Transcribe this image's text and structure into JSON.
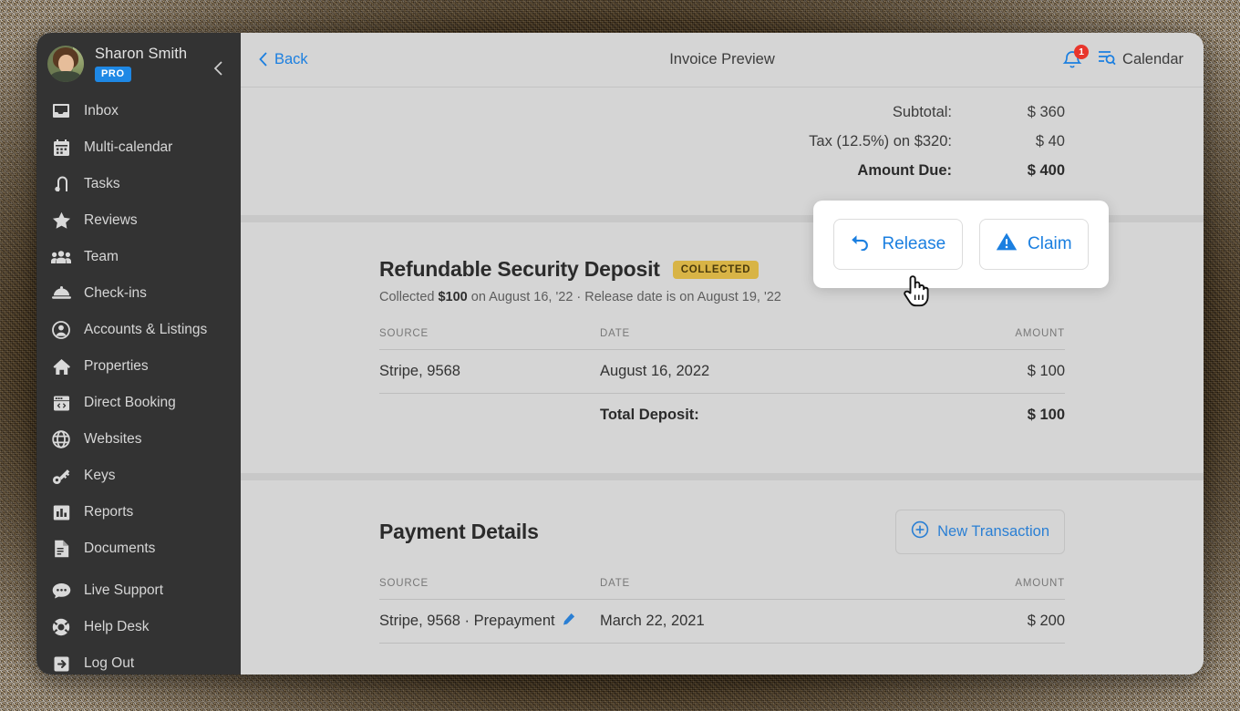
{
  "sidebar": {
    "user": {
      "name": "Sharon Smith",
      "badge": "PRO",
      "avatar_icon": "user-avatar-photo"
    },
    "collapse_icon": "chevron-left-icon",
    "items": [
      {
        "label": "Inbox",
        "icon": "inbox-icon"
      },
      {
        "label": "Multi-calendar",
        "icon": "calendar-icon"
      },
      {
        "label": "Tasks",
        "icon": "tasks-icon"
      },
      {
        "label": "Reviews",
        "icon": "star-icon"
      },
      {
        "label": "Team",
        "icon": "team-icon"
      },
      {
        "label": "Check-ins",
        "icon": "bell-service-icon"
      },
      {
        "label": "Accounts & Listings",
        "icon": "user-circle-icon"
      },
      {
        "label": "Properties",
        "icon": "home-icon"
      },
      {
        "label": "Direct Booking",
        "icon": "code-window-icon"
      },
      {
        "label": "Websites",
        "icon": "globe-icon"
      },
      {
        "label": "Keys",
        "icon": "key-icon"
      },
      {
        "label": "Reports",
        "icon": "bar-chart-icon"
      },
      {
        "label": "Documents",
        "icon": "document-icon"
      },
      {
        "label": "Live Support",
        "icon": "chat-bubble-icon"
      },
      {
        "label": "Help Desk",
        "icon": "lifebuoy-icon"
      },
      {
        "label": "Log Out",
        "icon": "logout-icon"
      }
    ]
  },
  "topbar": {
    "back_label": "Back",
    "back_icon": "chevron-left-icon",
    "title": "Invoice Preview",
    "bell_icon": "notification-bell-icon",
    "bell_count": "1",
    "calendar_icon": "calendar-search-icon",
    "calendar_label": "Calendar"
  },
  "totals": [
    {
      "label": "Subtotal:",
      "value": "$ 360",
      "emphasis": false
    },
    {
      "label": "Tax (12.5%) on $320:",
      "value": "$ 40",
      "emphasis": false
    },
    {
      "label": "Amount Due:",
      "value": "$ 400",
      "emphasis": true
    }
  ],
  "deposit": {
    "title": "Refundable Security Deposit",
    "badge": "COLLECTED",
    "sub_prefix": "Collected ",
    "sub_amount": "$100",
    "sub_suffix": " on August 16, '22 · Release date is on August 19, '22",
    "columns": {
      "source": "SOURCE",
      "date": "DATE",
      "amount": "AMOUNT"
    },
    "rows": [
      {
        "source": "Stripe, 9568",
        "date": "August 16, 2022",
        "amount": "$ 100"
      }
    ],
    "total_label": "Total Deposit:",
    "total_amount": "$ 100"
  },
  "popover": {
    "release_label": "Release",
    "release_icon": "undo-arrow-icon",
    "claim_label": "Claim",
    "claim_icon": "warning-triangle-icon"
  },
  "payments": {
    "title": "Payment Details",
    "new_transaction_label": "New Transaction",
    "new_transaction_icon": "plus-circle-icon",
    "columns": {
      "source": "SOURCE",
      "date": "DATE",
      "amount": "AMOUNT"
    },
    "rows": [
      {
        "source": "Stripe, 9568 · Prepayment",
        "edit_icon": "pencil-icon",
        "date": "March 22, 2021",
        "amount": "$ 200"
      }
    ]
  },
  "cursor": {
    "icon": "pointing-hand-cursor"
  },
  "colors": {
    "accent_blue": "#1b7fe0",
    "badge_gold": "#d8b446",
    "alert_red": "#e8352c",
    "sidebar_bg": "#333333",
    "content_bg": "#d5d5d5"
  }
}
